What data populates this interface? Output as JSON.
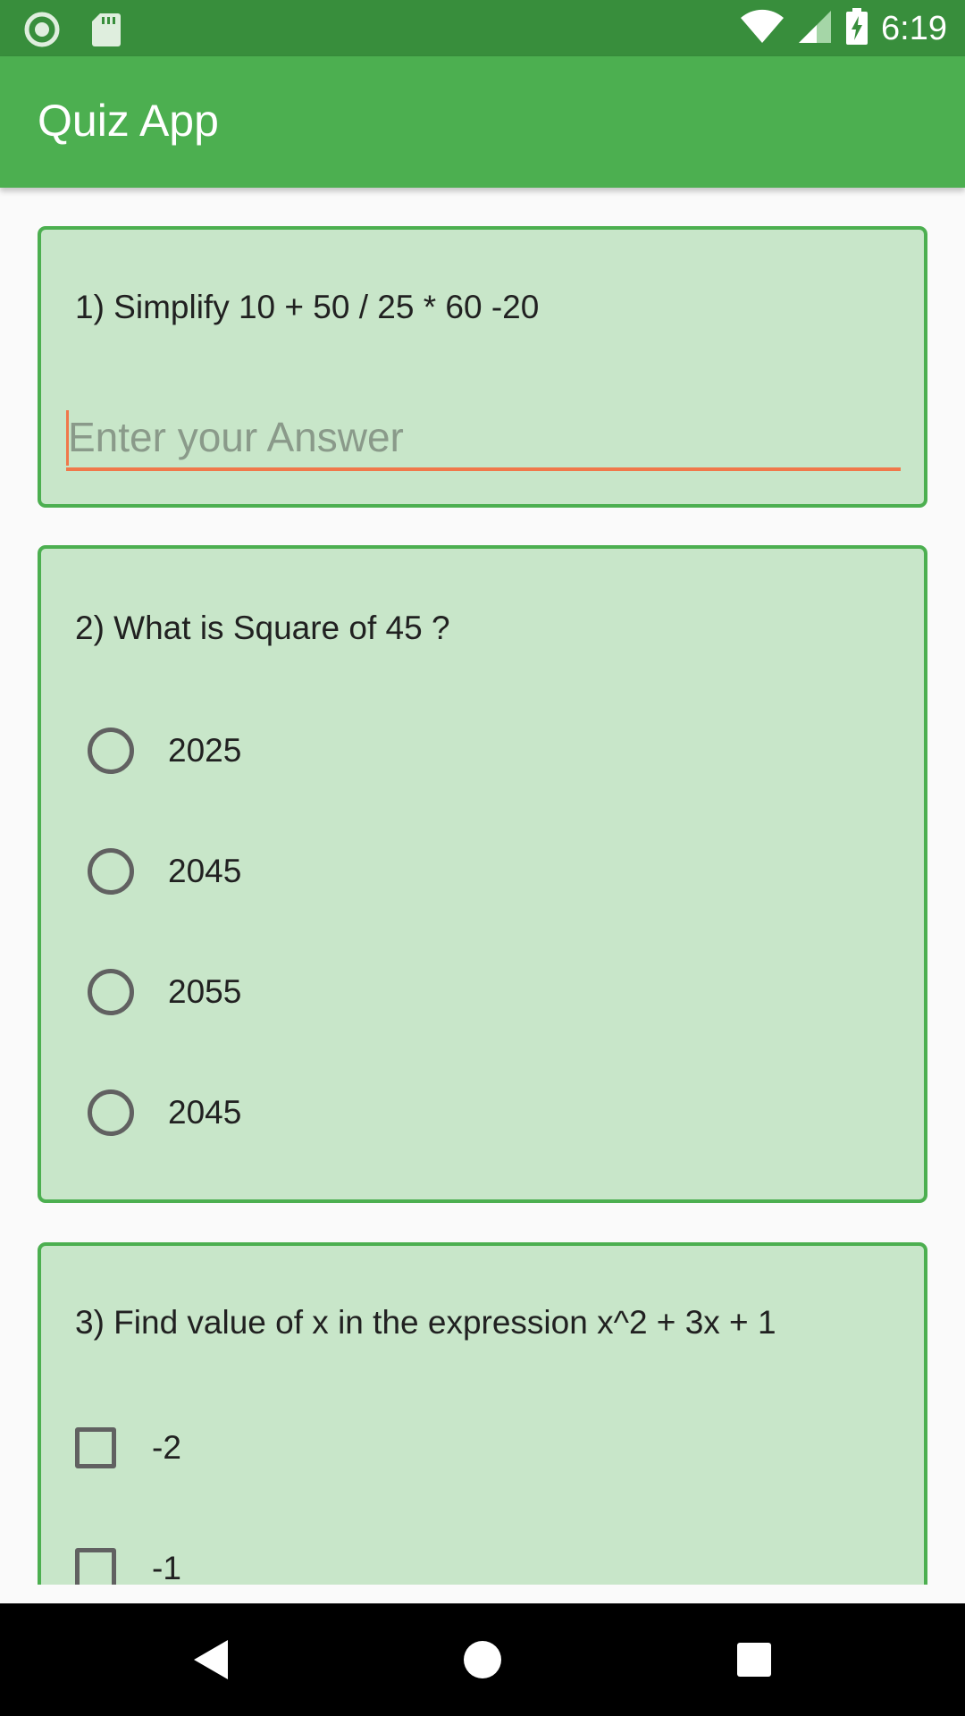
{
  "status_bar": {
    "time": "6:19",
    "icons": [
      "record-icon",
      "sd-card-icon",
      "wifi-icon",
      "signal-icon",
      "battery-charging-icon"
    ]
  },
  "app_bar": {
    "title": "Quiz App"
  },
  "colors": {
    "status_bar": "#388e3c",
    "app_bar": "#4caf50",
    "card_bg": "#c8e6c9",
    "card_border": "#4caf50",
    "input_accent": "#f0784a"
  },
  "questions": [
    {
      "text": "1) Simplify 10 + 50 / 25 * 60 -20",
      "input": {
        "value": "",
        "placeholder": "Enter your Answer"
      }
    },
    {
      "text": "2) What is Square of 45 ?",
      "options": [
        "2025",
        "2045",
        "2055",
        "2045"
      ]
    },
    {
      "text": "3) Find value of x in the expression x^2 + 3x + 1",
      "options": [
        "-2",
        "-1"
      ]
    }
  ],
  "nav_bar": {
    "icons": [
      "back-icon",
      "home-icon",
      "recents-icon"
    ]
  }
}
